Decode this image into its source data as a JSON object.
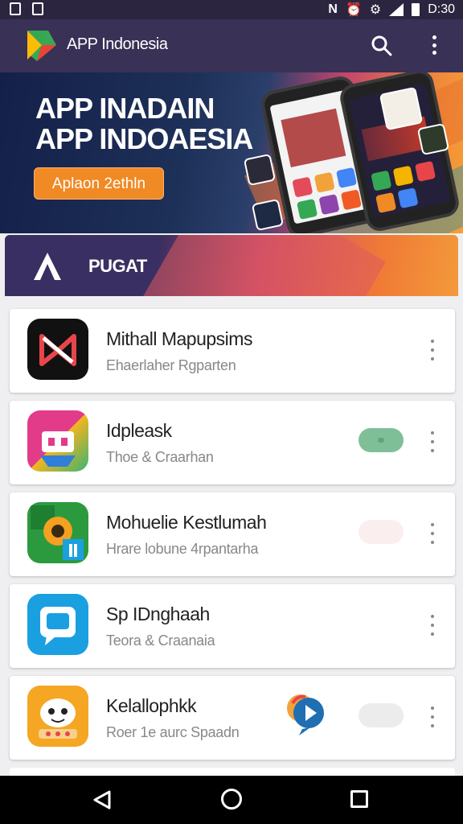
{
  "status_bar": {
    "time": "D:30",
    "left_icons": [
      "download-icon",
      "notification-icon"
    ],
    "right_icons": [
      "nfc-icon",
      "alarm-icon",
      "sync-icon",
      "signal-icon",
      "battery-icon"
    ]
  },
  "app_bar": {
    "title": "APP Indonesia",
    "logo_icon": "store-logo-icon",
    "actions": [
      "search-icon",
      "more-vert-icon"
    ]
  },
  "banner": {
    "title_line1": "APP INADAIN",
    "title_line2": "APP INDOAESIA",
    "button_label": "Aplaon 2ethln",
    "accent_color": "#f08a24"
  },
  "category": {
    "title": "PUGAT",
    "logo_icon": "a-logo-icon"
  },
  "apps": [
    {
      "name": "Mithall Mapupsims",
      "subtitle": "Ehaerlaher Rgparten",
      "icon": "x-logo-icon",
      "icon_colors": [
        "#111111",
        "#e8454b"
      ],
      "pill_color": "",
      "has_chat_badge": false
    },
    {
      "name": "Idpleask",
      "subtitle": "Thoe & Craarhan",
      "icon": "store-bag-icon",
      "icon_colors": [
        "#e23b8a",
        "#f6b51e"
      ],
      "pill_color": "#7fbf98",
      "has_chat_badge": false
    },
    {
      "name": "Mohuelie Kestlumah",
      "subtitle": "Hrare lobune 4rpantarha",
      "icon": "map-photo-icon",
      "icon_colors": [
        "#2b9a3e",
        "#f4a020"
      ],
      "pill_color": "#fbeeee",
      "has_chat_badge": false
    },
    {
      "name": "Sp IDnghaah",
      "subtitle": "Teora & Craanaia",
      "icon": "chat-bubble-icon",
      "icon_colors": [
        "#1aa0e0",
        "#ffffff"
      ],
      "pill_color": "",
      "has_chat_badge": false
    },
    {
      "name": "Kelallophkk",
      "subtitle": "Roer 1e aurc Spaadn",
      "icon": "robot-face-icon",
      "icon_colors": [
        "#f5a623",
        "#ffffff"
      ],
      "pill_color": "#ececec",
      "has_chat_badge": true
    }
  ],
  "nav_bar": {
    "buttons": [
      "back-icon",
      "home-icon",
      "recents-icon"
    ]
  }
}
